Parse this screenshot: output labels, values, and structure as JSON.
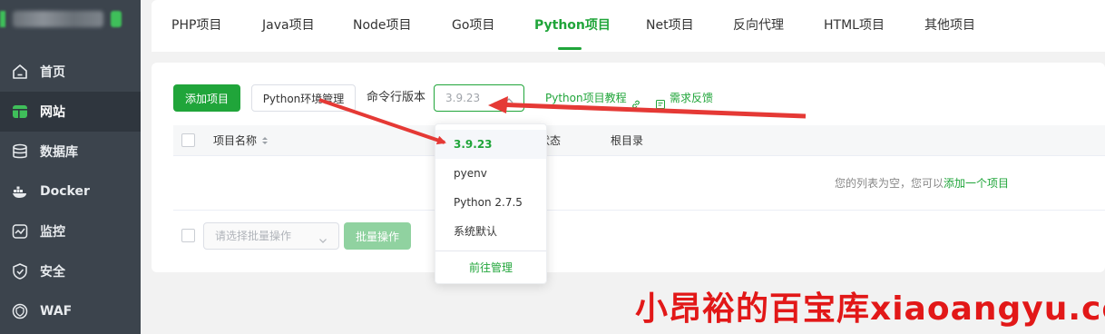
{
  "sidebar": {
    "brand_blurred": true,
    "items": [
      {
        "label": "首页",
        "icon": "home-icon"
      },
      {
        "label": "网站",
        "icon": "website-icon",
        "active": true
      },
      {
        "label": "数据库",
        "icon": "database-icon"
      },
      {
        "label": "Docker",
        "icon": "docker-icon"
      },
      {
        "label": "监控",
        "icon": "monitor-icon"
      },
      {
        "label": "安全",
        "icon": "shield-icon"
      },
      {
        "label": "WAF",
        "icon": "waf-icon"
      }
    ]
  },
  "tabs": [
    {
      "label": "PHP项目"
    },
    {
      "label": "Java项目"
    },
    {
      "label": "Node项目"
    },
    {
      "label": "Go项目"
    },
    {
      "label": "Python项目",
      "active": true
    },
    {
      "label": "Net项目"
    },
    {
      "label": "反向代理"
    },
    {
      "label": "HTML项目"
    },
    {
      "label": "其他项目"
    }
  ],
  "toolbar": {
    "add_project": "添加项目",
    "python_env": "Python环境管理",
    "cli_version_label": "命令行版本",
    "cli_version_value": "3.9.23",
    "tutorial_link": "Python项目教程",
    "feedback_link": "需求反馈"
  },
  "table": {
    "headers": {
      "name": "项目名称",
      "status": "状态",
      "root": "根目录"
    },
    "empty_prefix": "您的列表为空，您可以",
    "empty_link": "添加一个项目"
  },
  "batch": {
    "placeholder": "请选择批量操作",
    "button": "批量操作"
  },
  "dropdown": {
    "options": [
      "3.9.23",
      "pyenv",
      "Python 2.7.5",
      "系统默认"
    ],
    "selected": "3.9.23",
    "manage": "前往管理"
  },
  "watermark": "小昂裕的百宝库xiaoangyu.cc",
  "colors": {
    "accent": "#20a53a",
    "sidebar_bg": "#3c444d",
    "arrow": "#e53935",
    "watermark": "#e21818"
  }
}
